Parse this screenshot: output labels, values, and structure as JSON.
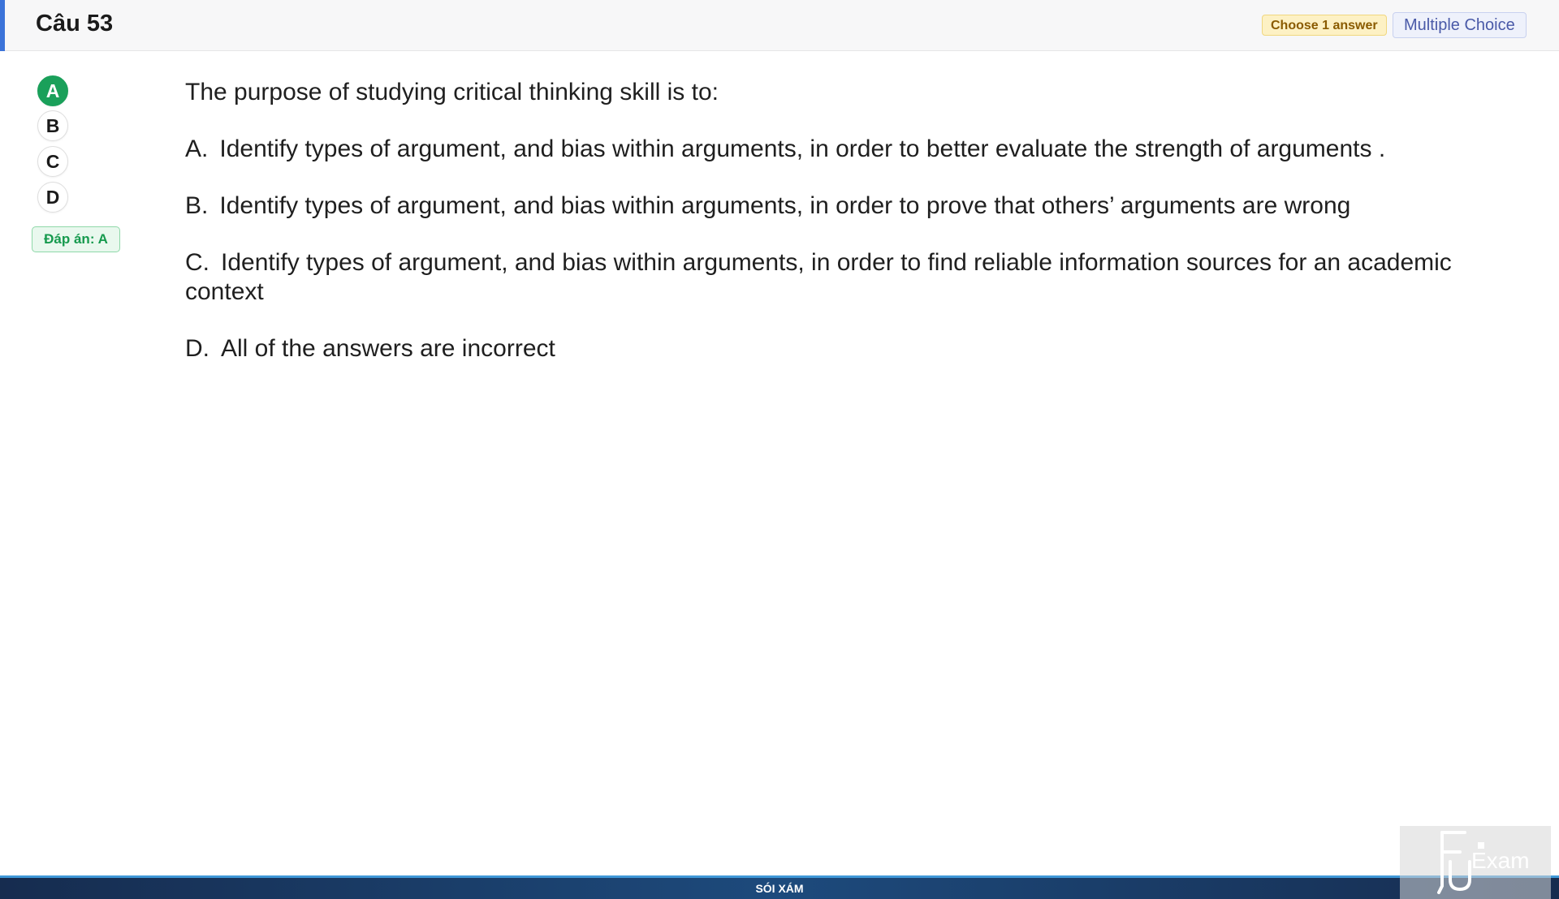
{
  "header": {
    "title": "Câu 53",
    "badge_choose": "Choose 1 answer",
    "badge_type": "Multiple Choice",
    "accent_color": "#3b73d9"
  },
  "sidebar": {
    "options": [
      {
        "letter": "A",
        "selected": true
      },
      {
        "letter": "B",
        "selected": false
      },
      {
        "letter": "C",
        "selected": false
      },
      {
        "letter": "D",
        "selected": false
      }
    ],
    "answer_label": "Đáp án: A",
    "selected_color": "#1aa05a"
  },
  "question": {
    "stem": "The purpose of studying critical thinking skill is to:",
    "options": [
      {
        "letter": "A.",
        "text": "Identify types of argument, and bias within arguments, in order to better evaluate the strength of arguments ."
      },
      {
        "letter": "B.",
        "text": "Identify types of argument, and bias within arguments, in order to prove that others’ arguments are wrong"
      },
      {
        "letter": "C.",
        "text": "Identify types of argument, and bias within arguments, in order to find reliable information sources for an academic context"
      },
      {
        "letter": "D.",
        "text": "All of the answers are incorrect"
      }
    ]
  },
  "footer": {
    "text": "SÓI XÁM"
  },
  "watermark": {
    "text": "FU Exam",
    "icon": "fu-exam-logo-icon"
  }
}
